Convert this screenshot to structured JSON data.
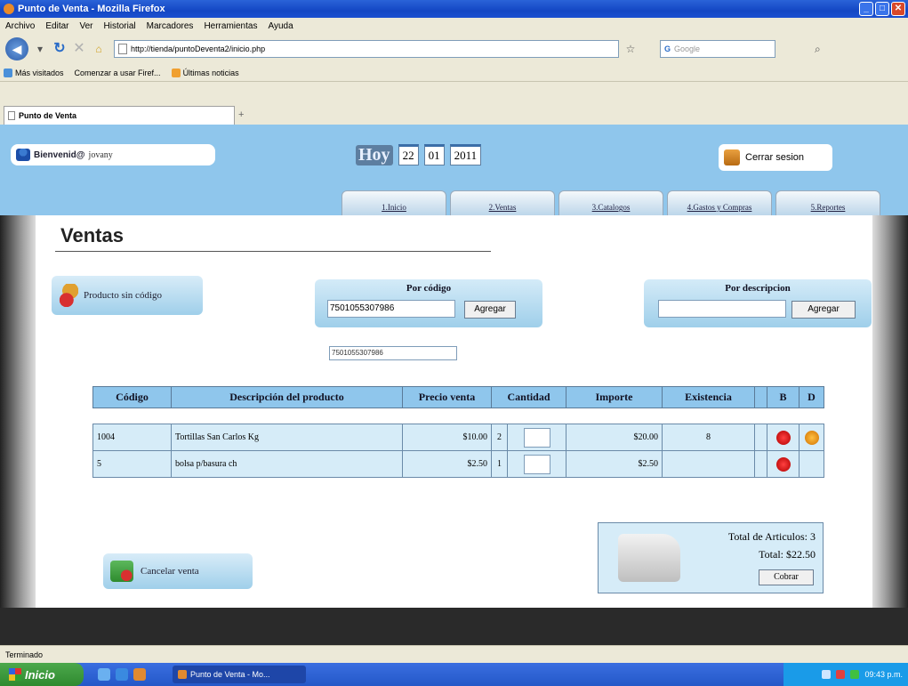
{
  "window": {
    "title": "Punto de Venta - Mozilla Firefox",
    "buttons": [
      "_",
      "□",
      "✕"
    ]
  },
  "menubar": [
    "Archivo",
    "Editar",
    "Ver",
    "Historial",
    "Marcadores",
    "Herramientas",
    "Ayuda"
  ],
  "navbar": {
    "url": "http://tienda/puntoDeventa2/inicio.php",
    "search_placeholder": "Google"
  },
  "bookmarks": [
    "Más visitados",
    "Comenzar a usar Firef...",
    "Últimas noticias"
  ],
  "tab": {
    "label": "Punto de Venta",
    "new_tab": "+"
  },
  "header": {
    "welcome_label": "Bienvenid@",
    "welcome_user": "jovany",
    "hoy_label": "Hoy",
    "date_day": "22",
    "date_month": "01",
    "date_year": "2011",
    "logout_label": "Cerrar sesion"
  },
  "menu_tabs": [
    "1.Inicio",
    "2.Ventas",
    "3.Catalogos",
    "4.Gastos y Compras",
    "5.Reportes"
  ],
  "main": {
    "title": "Ventas",
    "no_code_button": "Producto sin código",
    "by_code": {
      "title": "Por código",
      "value": "7501055307986",
      "button": "Agregar",
      "suggestion": "7501055307986"
    },
    "by_desc": {
      "title": "Por descripcion",
      "value": "",
      "button": "Agregar"
    },
    "table": {
      "headers": [
        "Código",
        "Descripción del producto",
        "Precio venta",
        "Cantidad",
        "Importe",
        "Existencia",
        "B",
        "D"
      ],
      "rows": [
        {
          "code": "1004",
          "desc": "Tortillas San Carlos Kg",
          "price": "$10.00",
          "qty": "2",
          "amount": "$20.00",
          "stock": "8"
        },
        {
          "code": "5",
          "desc": "bolsa p/basura ch",
          "price": "$2.50",
          "qty": "1",
          "amount": "$2.50",
          "stock": ""
        }
      ]
    },
    "totals": {
      "items_label": "Total de Articulos: 3",
      "total_label": "Total: $22.50",
      "charge_button": "Cobrar"
    },
    "cancel_button": "Cancelar venta"
  },
  "statusbar": {
    "text": "Terminado"
  },
  "taskbar": {
    "start": "Inicio",
    "task": "Punto de Venta - Mo...",
    "clock": "09:43 p.m."
  }
}
